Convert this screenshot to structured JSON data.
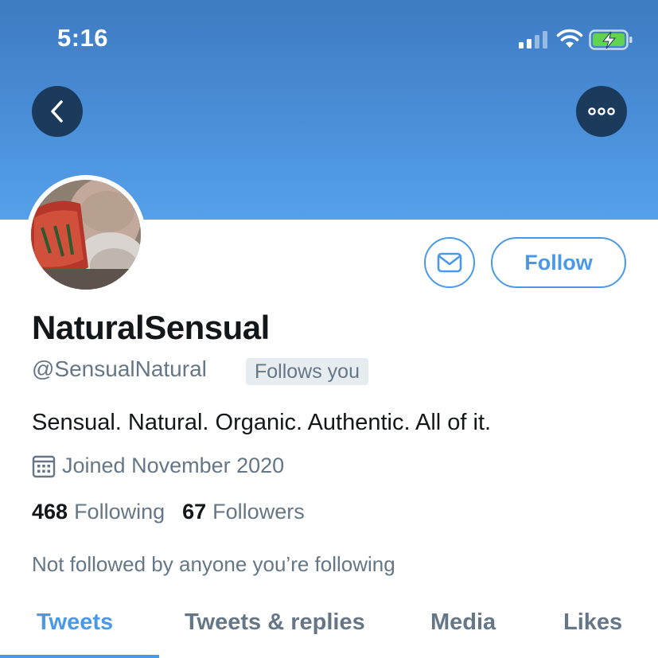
{
  "status_bar": {
    "time": "5:16",
    "icons": [
      "signal-icon",
      "wifi-icon",
      "battery-charging-icon"
    ]
  },
  "header": {
    "back_icon": "chevron-left-icon",
    "more_icon": "more-horizontal-icon",
    "banner_color": "#4a8fd8"
  },
  "profile": {
    "display_name": "NaturalSensual",
    "handle": "@SensualNatural",
    "follows_you": "Follows you",
    "bio": "Sensual. Natural. Organic. Authentic. All of it.",
    "joined": "Joined November 2020",
    "following_count": "468",
    "following_label": "Following",
    "followers_count": "67",
    "followers_label": "Followers",
    "not_followed": "Not followed by anyone you’re following"
  },
  "actions": {
    "message_icon": "envelope-icon",
    "follow_label": "Follow"
  },
  "tabs": [
    {
      "label": "Tweets",
      "active": true
    },
    {
      "label": "Tweets & replies",
      "active": false
    },
    {
      "label": "Media",
      "active": false
    },
    {
      "label": "Likes",
      "active": false
    }
  ],
  "colors": {
    "accent": "#4a99e9",
    "text_primary": "#14171a",
    "text_secondary": "#657786"
  }
}
